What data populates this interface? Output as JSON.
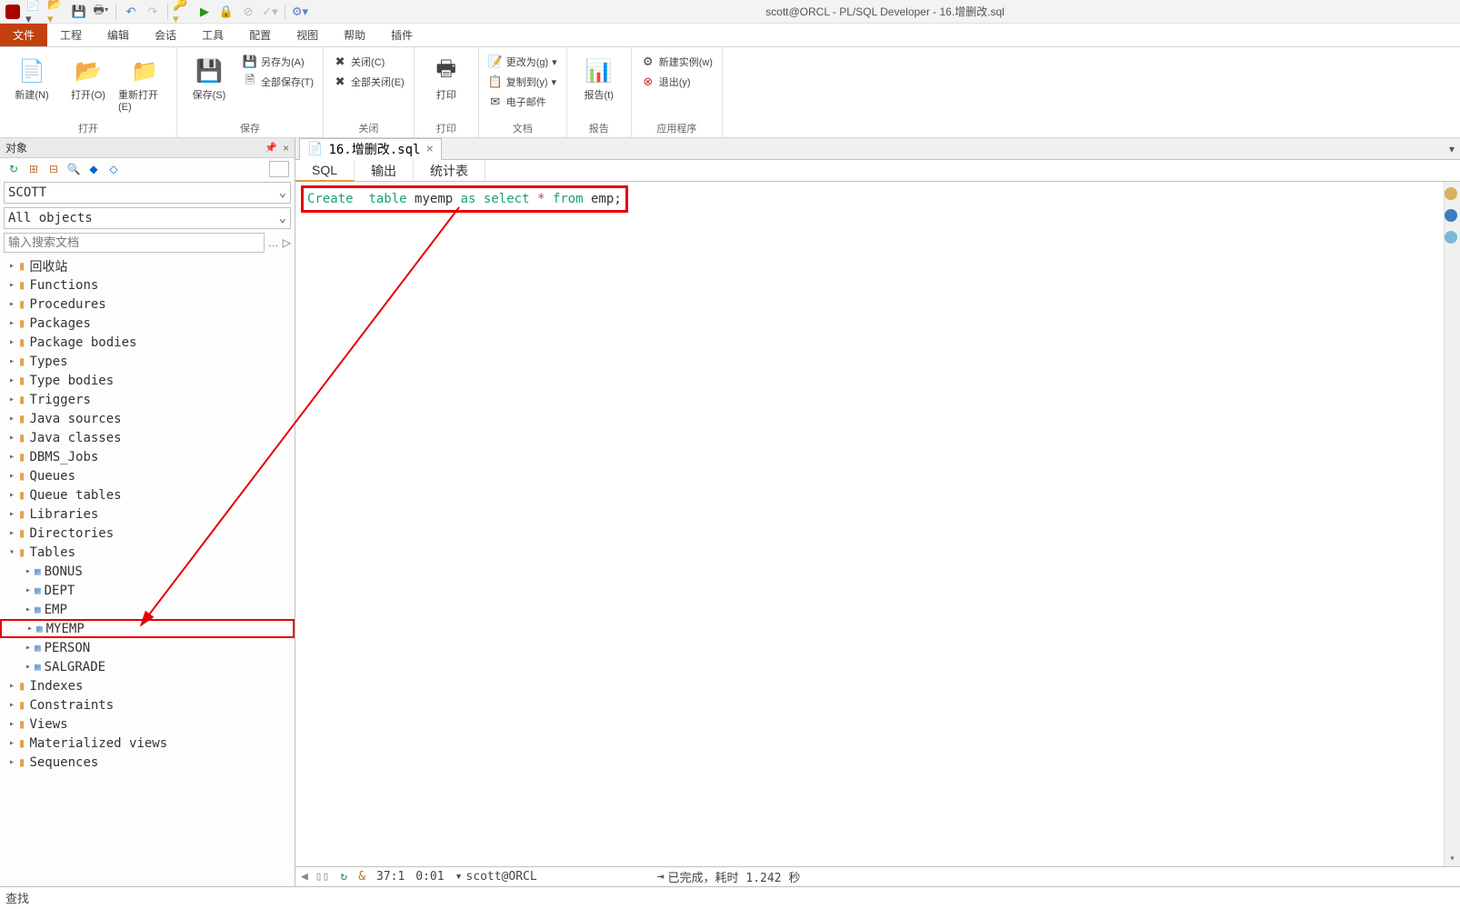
{
  "title": "scott@ORCL - PL/SQL Developer - 16.增删改.sql",
  "menu": {
    "file": "文件",
    "project": "工程",
    "edit": "编辑",
    "session": "会话",
    "tools": "工具",
    "config": "配置",
    "view": "视图",
    "help": "帮助",
    "plugin": "插件"
  },
  "ribbon": {
    "open_group": "打开",
    "save_group": "保存",
    "close_group": "关闭",
    "print_group": "打印",
    "doc_group": "文档",
    "report_group": "报告",
    "app_group": "应用程序",
    "new": "新建(N)",
    "open": "打开(O)",
    "reopen": "重新打开(E)",
    "save": "保存(S)",
    "save_as": "另存为(A)",
    "save_all": "全部保存(T)",
    "close": "关闭(C)",
    "close_all": "全部关闭(E)",
    "print": "打印",
    "change_to": "更改为(g)",
    "copy_to": "复制到(y)",
    "email": "电子邮件",
    "report": "报告(t)",
    "new_instance": "新建实例(w)",
    "exit": "退出(y)"
  },
  "panel": {
    "title": "对象",
    "pin": "📌",
    "close": "×"
  },
  "combo_schema": "SCOTT",
  "combo_objects": "All objects",
  "search_placeholder": "输入搜索文档",
  "tree": {
    "items": [
      {
        "label": "回收站",
        "level": 0,
        "type": "folder"
      },
      {
        "label": "Functions",
        "level": 0,
        "type": "folder"
      },
      {
        "label": "Procedures",
        "level": 0,
        "type": "folder"
      },
      {
        "label": "Packages",
        "level": 0,
        "type": "folder"
      },
      {
        "label": "Package bodies",
        "level": 0,
        "type": "folder"
      },
      {
        "label": "Types",
        "level": 0,
        "type": "folder"
      },
      {
        "label": "Type bodies",
        "level": 0,
        "type": "folder"
      },
      {
        "label": "Triggers",
        "level": 0,
        "type": "folder"
      },
      {
        "label": "Java sources",
        "level": 0,
        "type": "folder"
      },
      {
        "label": "Java classes",
        "level": 0,
        "type": "folder"
      },
      {
        "label": "DBMS_Jobs",
        "level": 0,
        "type": "folder"
      },
      {
        "label": "Queues",
        "level": 0,
        "type": "folder"
      },
      {
        "label": "Queue tables",
        "level": 0,
        "type": "folder"
      },
      {
        "label": "Libraries",
        "level": 0,
        "type": "folder"
      },
      {
        "label": "Directories",
        "level": 0,
        "type": "folder"
      },
      {
        "label": "Tables",
        "level": 0,
        "type": "folder",
        "expanded": true
      },
      {
        "label": "BONUS",
        "level": 1,
        "type": "table"
      },
      {
        "label": "DEPT",
        "level": 1,
        "type": "table"
      },
      {
        "label": "EMP",
        "level": 1,
        "type": "table"
      },
      {
        "label": "MYEMP",
        "level": 1,
        "type": "table",
        "highlight": true
      },
      {
        "label": "PERSON",
        "level": 1,
        "type": "table"
      },
      {
        "label": "SALGRADE",
        "level": 1,
        "type": "table"
      },
      {
        "label": "Indexes",
        "level": 0,
        "type": "folder"
      },
      {
        "label": "Constraints",
        "level": 0,
        "type": "folder"
      },
      {
        "label": "Views",
        "level": 0,
        "type": "folder"
      },
      {
        "label": "Materialized views",
        "level": 0,
        "type": "folder"
      },
      {
        "label": "Sequences",
        "level": 0,
        "type": "folder"
      }
    ]
  },
  "doc_tab": "16.增删改.sql",
  "sub_tabs": {
    "sql": "SQL",
    "output": "输出",
    "stats": "统计表"
  },
  "sql": {
    "create": "Create",
    "table": "table",
    "myemp": "myemp",
    "as": "as",
    "select": "select",
    "star": "*",
    "from": "from",
    "emp": "emp;"
  },
  "status": {
    "amp": "&",
    "pos": "37:1",
    "time": "0:01",
    "conn": "scott@ORCL",
    "done": "已完成，耗时 1.242 秒"
  },
  "find_label": "查找"
}
